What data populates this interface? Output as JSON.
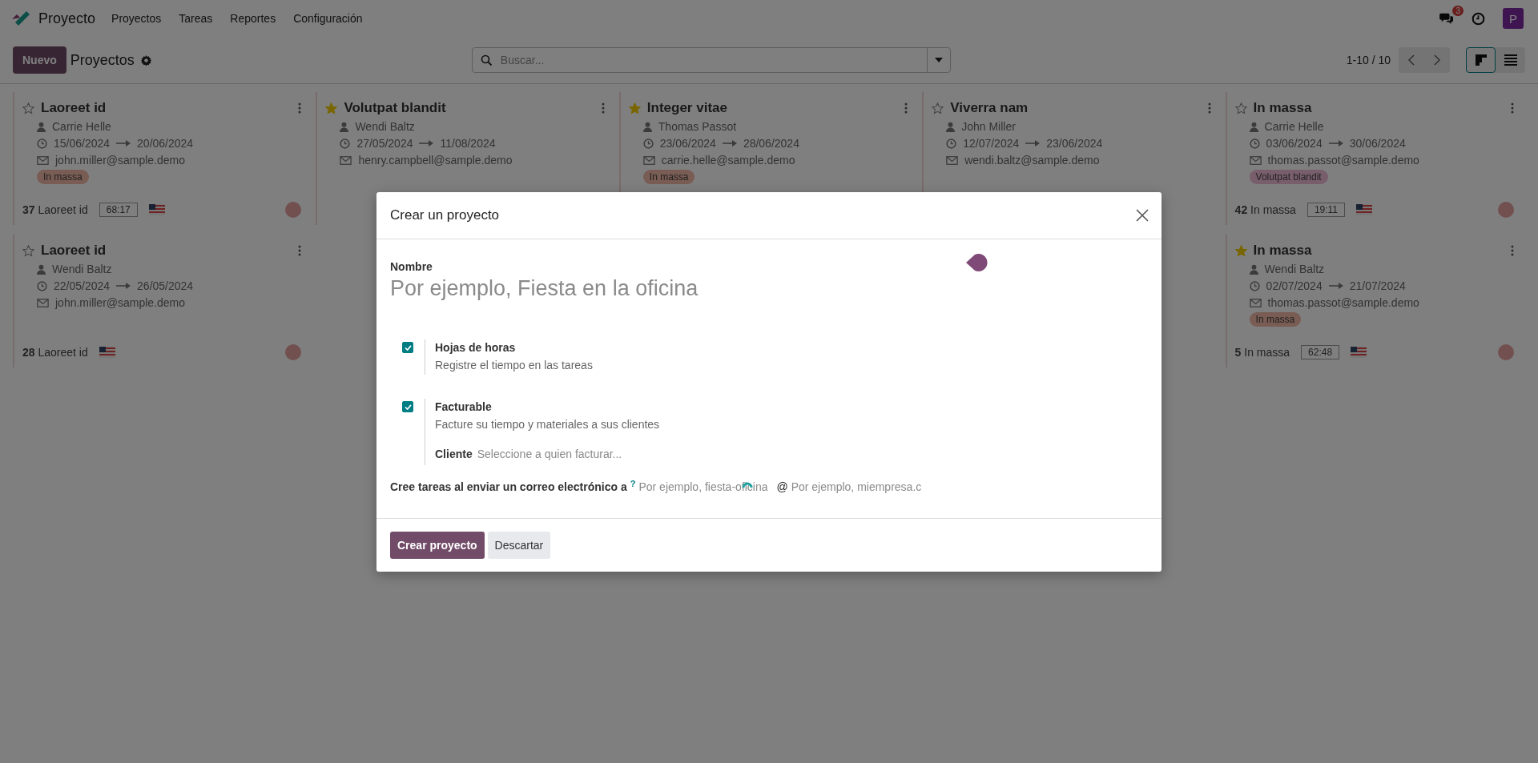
{
  "navbar": {
    "app_name": "Proyecto",
    "menus": [
      "Proyectos",
      "Tareas",
      "Reportes",
      "Configuración"
    ],
    "messages_badge": "3",
    "avatar": "P"
  },
  "control_panel": {
    "new_button": "Nuevo",
    "title": "Proyectos",
    "search_placeholder": "Buscar...",
    "pager": "1-10 / 10",
    "views": [
      {
        "kind": "kanban",
        "selected": true
      },
      {
        "kind": "list",
        "selected": false
      }
    ]
  },
  "kanban": {
    "cards": [
      {
        "title": "Laoreet id",
        "favorite": false,
        "user": "Carrie Helle",
        "start": "15/06/2024",
        "end": "20/06/2024",
        "email": "john.miller@sample.demo",
        "tag": "In massa",
        "color": "#795c53",
        "count": "37",
        "footer_name": "Laoreet id",
        "time": "68:17"
      },
      {
        "title": "Volutpat blandit",
        "favorite": true,
        "user": "Wendi Baltz",
        "start": "27/05/2024",
        "end": "11/08/2024",
        "email": "henry.campbell@sample.demo"
      },
      {
        "title": "Integer vitae",
        "favorite": true,
        "user": "Thomas Passot",
        "start": "23/06/2024",
        "end": "28/06/2024",
        "email": "carrie.helle@sample.demo",
        "tag": "In massa",
        "color": "#795c53"
      },
      {
        "title": "Viverra nam",
        "favorite": false,
        "user": "John Miller",
        "start": "12/07/2024",
        "end": "23/06/2024",
        "email": "wendi.baltz@sample.demo"
      },
      {
        "title": "In massa",
        "favorite": false,
        "user": "Carrie Helle",
        "start": "03/06/2024",
        "end": "30/06/2024",
        "email": "thomas.passot@sample.demo",
        "tag": "Volutpat blandit",
        "color": "#785e6b",
        "count": "42",
        "footer_name": "In massa",
        "time": "19:11"
      },
      {
        "title": "Laoreet id",
        "favorite": false,
        "user": "Wendi Baltz",
        "start": "22/05/2024",
        "end": "26/05/2024",
        "email": "john.miller@sample.demo",
        "count": "28",
        "footer_name": "Laoreet id"
      },
      {
        "title": "In massa",
        "favorite": true,
        "user": "Wendi Baltz",
        "start": "02/07/2024",
        "end": "21/07/2024",
        "email": "thomas.passot@sample.demo",
        "tag": "In massa",
        "color": "#795c53",
        "count": "5",
        "footer_name": "In massa",
        "time": "62:48"
      }
    ]
  },
  "dialog": {
    "title": "Crear un proyecto",
    "name_label": "Nombre",
    "name_placeholder": "Por ejemplo, Fiesta en la oficina",
    "options": [
      {
        "label": "Hojas de horas",
        "description": "Registre el tiempo en las tareas",
        "checked": true
      },
      {
        "label": "Facturable",
        "description": "Facture su tiempo y materiales a sus clientes",
        "checked": true,
        "customer_label": "Cliente",
        "customer_placeholder": "Seleccione a quien facturar..."
      }
    ],
    "email_label": "Cree tareas al enviar un correo electrónico a",
    "email_help": "?",
    "alias_placeholder": "Por ejemplo, fiesta-oficina",
    "at": "@",
    "domain_placeholder": "Por ejemplo, miempresa.c",
    "buttons": [
      {
        "label": "Crear proyecto",
        "kind": "primary"
      },
      {
        "label": "Descartar",
        "kind": "secondary"
      }
    ]
  }
}
